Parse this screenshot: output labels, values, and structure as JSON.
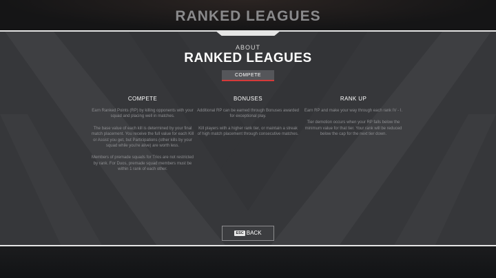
{
  "screen": {
    "title": "RANKED LEAGUES"
  },
  "panel": {
    "about_label": "ABOUT",
    "title": "RANKED LEAGUES",
    "tab_label": "COMPETE",
    "accent_color": "#d63a3a"
  },
  "columns": [
    {
      "heading": "COMPETE",
      "paragraphs": [
        "Earn Ranked Points (RP) by killing opponents with your squad and placing well in matches.",
        "The base value of each kill is determined by your final match placement. You receive the full value for each Kill or Assist you get, but Participations (other kills by your squad while you're alive) are worth less.",
        "Members of premade squads for Trios are not restricted by rank. For Duos, premade squad members must be within 1 rank of each other."
      ]
    },
    {
      "heading": "BONUSES",
      "paragraphs": [
        "Additional RP can be earned through Bonuses awarded for exceptional play.",
        "Kill players with a higher rank tier, or maintain a streak of high match placement through consecutive matches."
      ]
    },
    {
      "heading": "RANK UP",
      "paragraphs": [
        "Earn RP and make your way through each rank IV - I.",
        "Tier demotion occurs when your RP falls below the minimum value for that tier. Your rank will be reduced below the cap for the next tier down."
      ]
    }
  ],
  "footer": {
    "back_key": "ESC",
    "back_label": "BACK"
  },
  "icons": {
    "esc_key": "keyboard-key-icon"
  }
}
